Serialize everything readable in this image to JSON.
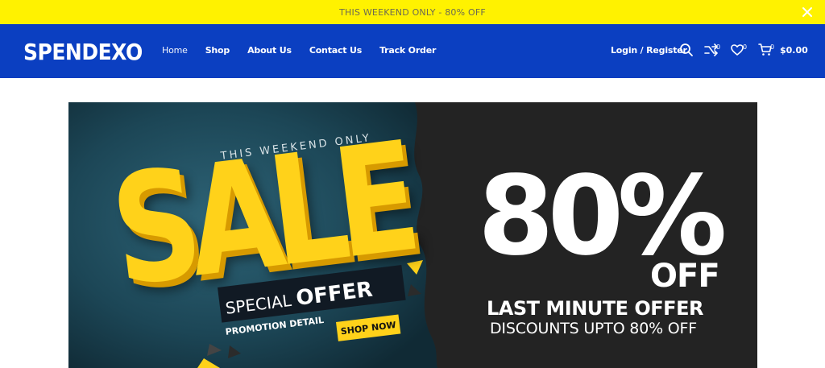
{
  "promo": {
    "text": "THIS WEEKEND ONLY - 80% OFF",
    "close_icon": "close-icon"
  },
  "header": {
    "logo": "SPENDEXO",
    "nav": [
      "Home",
      "Shop",
      "About Us",
      "Contact Us",
      "Track Order"
    ],
    "login": "Login / Register",
    "compare_count": "0",
    "wishlist_count": "0",
    "cart_count": "0",
    "cart_total": "$0.00",
    "icons": [
      "search-icon",
      "compare-icon",
      "heart-icon",
      "cart-icon"
    ]
  },
  "banner": {
    "weekend_only": "THIS WEEKEND ONLY",
    "sale": "SALE",
    "special": "SPECIAL",
    "offer": "OFFER",
    "promotion_detail": "PROMOTION DETAIL",
    "shop_now": "SHOP NOW",
    "percent": "80%",
    "off": "OFF",
    "last_minute": "LAST MINUTE OFFER",
    "discounts": "DISCOUNTS UPTO 80% OFF"
  },
  "colors": {
    "promo_bg": "#fff200",
    "header_bg": "#0b3fc1",
    "banner_dark": "#232323",
    "banner_teal": "#1f4a5a",
    "sale_yellow": "#ffd21a"
  }
}
